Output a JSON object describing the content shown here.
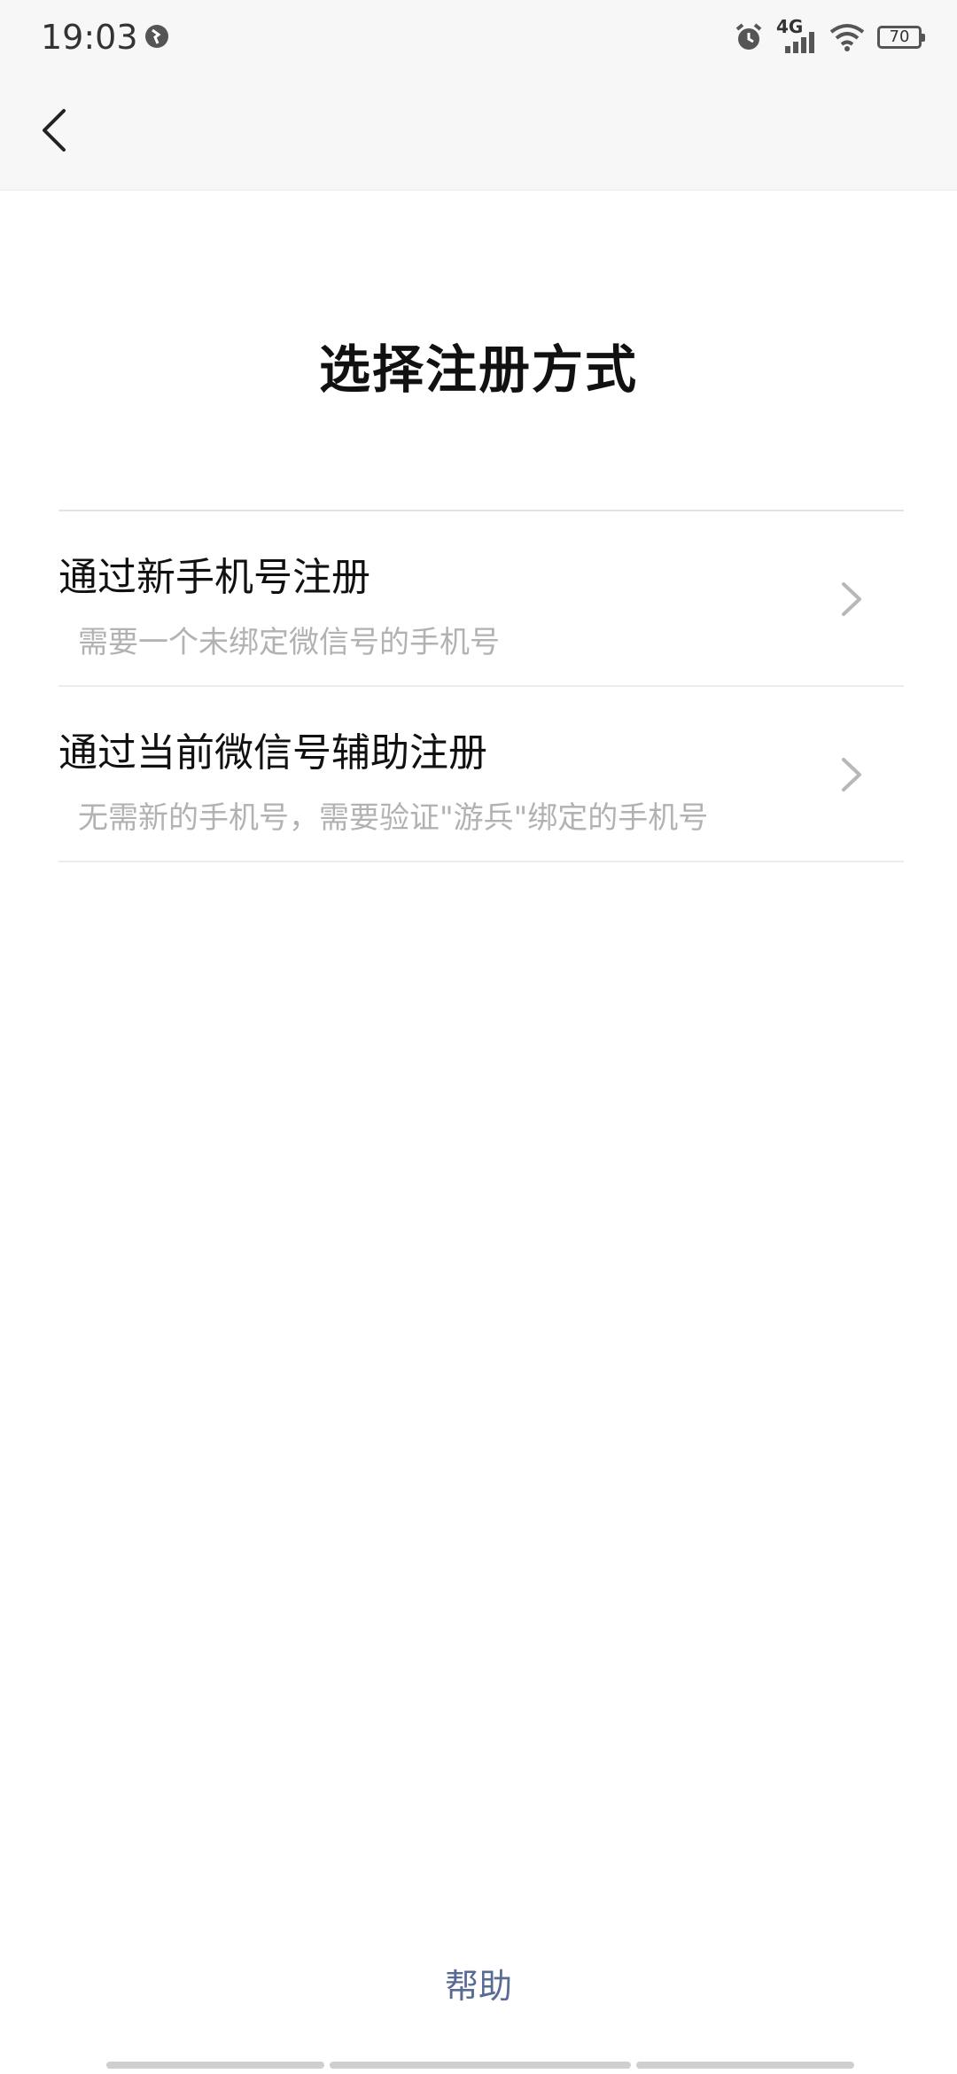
{
  "status_bar": {
    "time": "19:03",
    "network": "4G",
    "battery": "70",
    "icons": [
      "vpn-icon",
      "alarm-icon",
      "signal-icon",
      "wifi-icon",
      "battery-icon"
    ]
  },
  "nav": {
    "back_icon": "chevron-left-icon"
  },
  "page": {
    "title": "选择注册方式"
  },
  "options": [
    {
      "title": "通过新手机号注册",
      "description": "需要一个未绑定微信号的手机号",
      "arrow_icon": "chevron-right-icon"
    },
    {
      "title": "通过当前微信号辅助注册",
      "description": "无需新的手机号，需要验证\"游兵\"绑定的手机号",
      "arrow_icon": "chevron-right-icon"
    }
  ],
  "footer": {
    "help_label": "帮助",
    "help_color": "#576b95"
  }
}
